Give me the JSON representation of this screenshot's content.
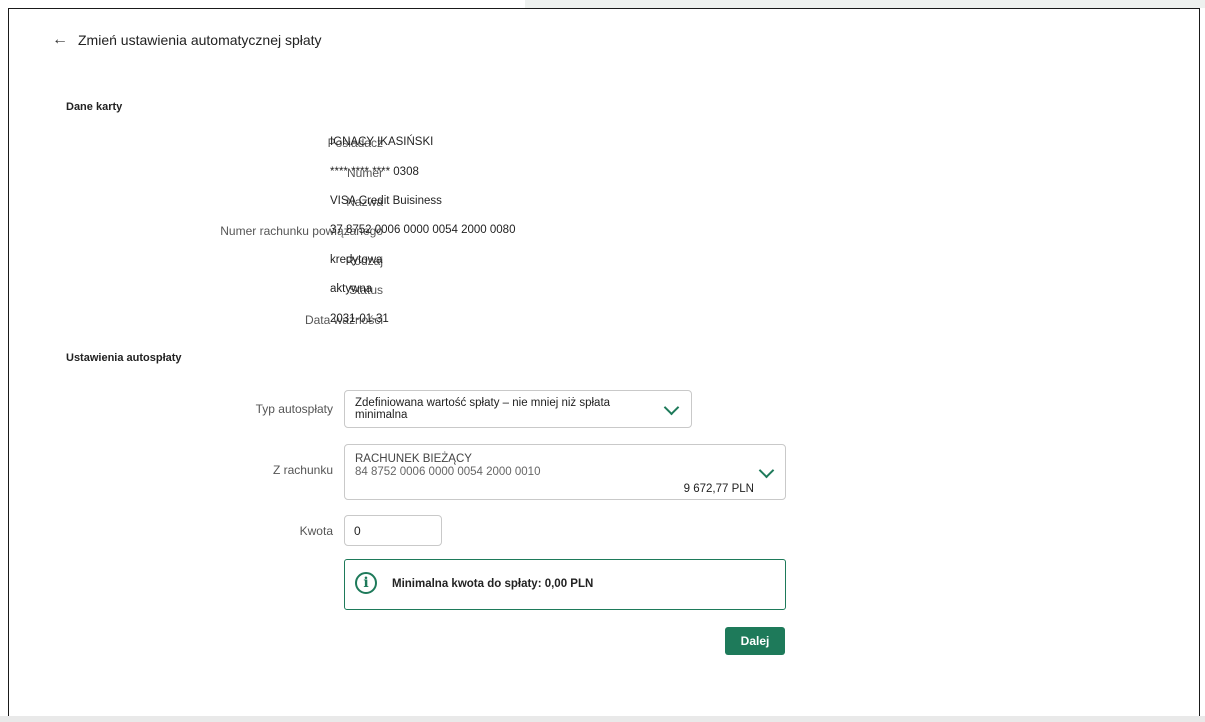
{
  "page": {
    "title": "Zmień ustawienia automatycznej spłaty"
  },
  "card_section": {
    "title": "Dane karty",
    "fields": [
      {
        "label": "Posiadacz",
        "value": "IGNACY IKASIŃSKI"
      },
      {
        "label": "Numer",
        "value": "**** **** **** 0308"
      },
      {
        "label": "Nazwa",
        "value": "VISA Credit Buisiness"
      },
      {
        "label": "Numer rachunku powiązanego",
        "value": "37 8752 0006 0000 0054 2000 0080"
      },
      {
        "label": "Rodzaj",
        "value": "kredytowa"
      },
      {
        "label": "Status",
        "value": "aktywna"
      },
      {
        "label": "Data ważności",
        "value": "2031-01-31"
      }
    ]
  },
  "autopay_section": {
    "title": "Ustawienia autospłaty",
    "type_label": "Typ autospłaty",
    "type_value": "Zdefiniowana wartość spłaty – nie mniej niż spłata minimalna",
    "account_label": "Z rachunku",
    "account_name": "RACHUNEK BIEŻĄCY",
    "account_number": "84 8752 0006 0000 0054 2000 0010",
    "account_balance": "9 672,77 PLN",
    "amount_label": "Kwota",
    "amount_value": "0",
    "info_text": "Minimalna kwota do spłaty: 0,00 PLN",
    "next_label": "Dalej"
  },
  "icons": {
    "back": "arrow-left-icon",
    "select_chevron": "chevron-down-icon",
    "info": "info-icon"
  },
  "colors": {
    "accent": "#1e7a5a"
  }
}
